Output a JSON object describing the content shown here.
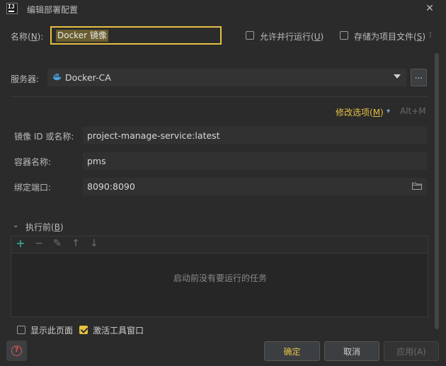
{
  "window": {
    "title": "编辑部署配置",
    "app_icon_text": "IJ"
  },
  "name_row": {
    "label": "名称(",
    "label_key": "N",
    "label_end": "):",
    "value": "Docker 镜像",
    "allow_parallel": {
      "label": "允许并行运行(",
      "key": "U",
      "end": ")",
      "checked": false
    },
    "store_as_project_file": {
      "label": "存储为项目文件(",
      "key": "S",
      "end": ")",
      "checked": false
    }
  },
  "server": {
    "label": "服务器:",
    "value": "Docker-CA",
    "more_label": "..."
  },
  "modify_options": {
    "label": "修改选项(",
    "key": "M",
    "end": ")",
    "shortcut": "Alt+M"
  },
  "fields": {
    "image_label": "镜像 ID 或名称:",
    "image_value": "project-manage-service:latest",
    "container_label": "容器名称:",
    "container_value": "pms",
    "port_label": "绑定端口:",
    "port_value": "8090:8090"
  },
  "before_launch": {
    "label": "执行前(",
    "key": "B",
    "end": ")",
    "empty_text": "启动前没有要运行的任务"
  },
  "footer_checks": {
    "show_page": {
      "label": "显示此页面",
      "checked": false
    },
    "activate_tool_window": {
      "label": "激活工具窗口",
      "checked": true
    }
  },
  "buttons": {
    "ok": "确定",
    "cancel": "取消",
    "apply": "应用(A)"
  },
  "colors": {
    "accent": "#e6c042",
    "background": "#2b2b2b",
    "help": "#e05555"
  }
}
